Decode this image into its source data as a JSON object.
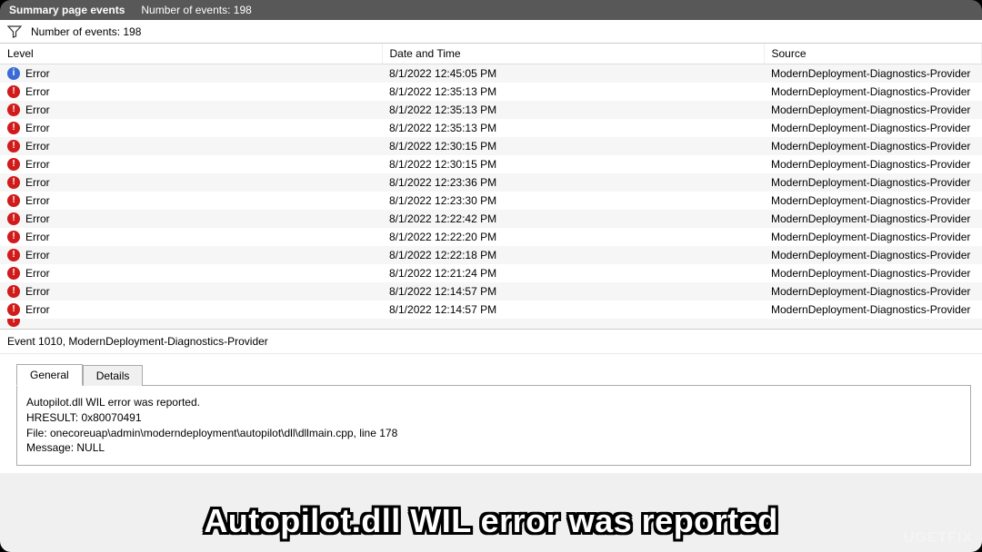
{
  "summary_bar": {
    "title": "Summary page events",
    "subtitle": "Number of events: 198"
  },
  "filter_bar": {
    "text": "Number of events: 198"
  },
  "columns": {
    "level": "Level",
    "date": "Date and Time",
    "source": "Source"
  },
  "events": [
    {
      "icon": "info",
      "level": "Error",
      "date": "8/1/2022 12:45:05 PM",
      "source": "ModernDeployment-Diagnostics-Provider"
    },
    {
      "icon": "error",
      "level": "Error",
      "date": "8/1/2022 12:35:13 PM",
      "source": "ModernDeployment-Diagnostics-Provider"
    },
    {
      "icon": "error",
      "level": "Error",
      "date": "8/1/2022 12:35:13 PM",
      "source": "ModernDeployment-Diagnostics-Provider"
    },
    {
      "icon": "error",
      "level": "Error",
      "date": "8/1/2022 12:35:13 PM",
      "source": "ModernDeployment-Diagnostics-Provider"
    },
    {
      "icon": "error",
      "level": "Error",
      "date": "8/1/2022 12:30:15 PM",
      "source": "ModernDeployment-Diagnostics-Provider"
    },
    {
      "icon": "error",
      "level": "Error",
      "date": "8/1/2022 12:30:15 PM",
      "source": "ModernDeployment-Diagnostics-Provider"
    },
    {
      "icon": "error",
      "level": "Error",
      "date": "8/1/2022 12:23:36 PM",
      "source": "ModernDeployment-Diagnostics-Provider"
    },
    {
      "icon": "error",
      "level": "Error",
      "date": "8/1/2022 12:23:30 PM",
      "source": "ModernDeployment-Diagnostics-Provider"
    },
    {
      "icon": "error",
      "level": "Error",
      "date": "8/1/2022 12:22:42 PM",
      "source": "ModernDeployment-Diagnostics-Provider"
    },
    {
      "icon": "error",
      "level": "Error",
      "date": "8/1/2022 12:22:20 PM",
      "source": "ModernDeployment-Diagnostics-Provider"
    },
    {
      "icon": "error",
      "level": "Error",
      "date": "8/1/2022 12:22:18 PM",
      "source": "ModernDeployment-Diagnostics-Provider"
    },
    {
      "icon": "error",
      "level": "Error",
      "date": "8/1/2022 12:21:24 PM",
      "source": "ModernDeployment-Diagnostics-Provider"
    },
    {
      "icon": "error",
      "level": "Error",
      "date": "8/1/2022 12:14:57 PM",
      "source": "ModernDeployment-Diagnostics-Provider"
    },
    {
      "icon": "error",
      "level": "Error",
      "date": "8/1/2022 12:14:57 PM",
      "source": "ModernDeployment-Diagnostics-Provider"
    }
  ],
  "details": {
    "header": "Event 1010, ModernDeployment-Diagnostics-Provider",
    "tabs": {
      "general": "General",
      "details": "Details"
    },
    "general_lines": [
      "Autopilot.dll WIL error was reported.",
      "HRESULT: 0x80070491",
      "File: onecoreuap\\admin\\moderndeployment\\autopilot\\dll\\dllmain.cpp, line 178",
      "Message: NULL"
    ]
  },
  "caption": "Autopilot.dll WIL error was reported",
  "watermark": "UGETFIX"
}
